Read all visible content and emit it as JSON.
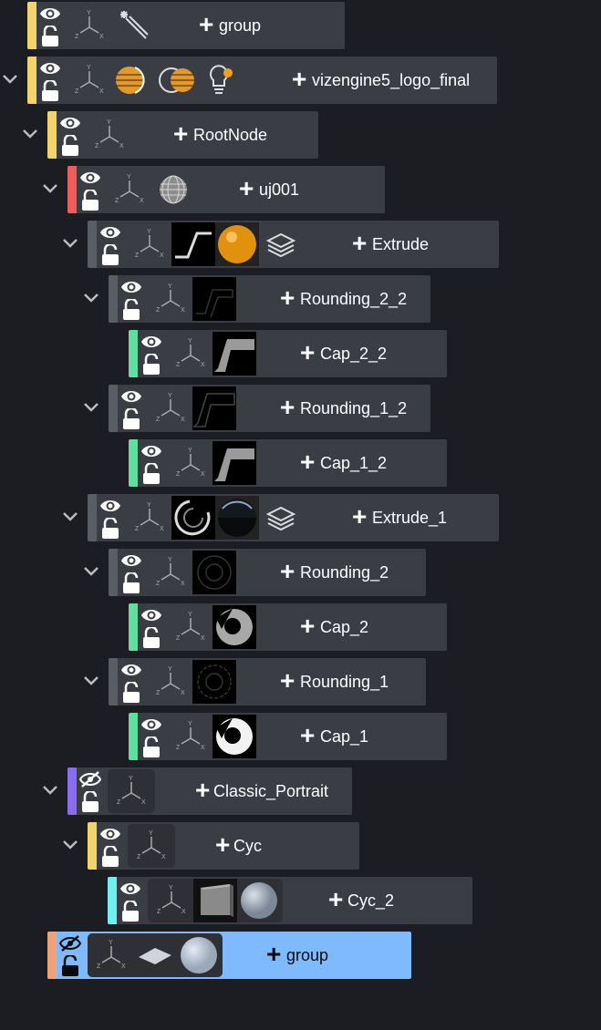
{
  "colors": {
    "background": "#1b1d22",
    "node_bg": "#3a3d44",
    "selected_bg": "#7fbaff",
    "yellow": "#f3d36b",
    "red": "#f05b5b",
    "green": "#5fe0a0",
    "purple": "#8a6cf0",
    "cyan": "#6ff0f0",
    "orange": "#f0a27a"
  },
  "nodes": [
    {
      "label": "group",
      "expander": false,
      "bar": "yellow",
      "visible": true,
      "thumbs": [
        "magic-wand-icon"
      ]
    },
    {
      "label": "vizengine5_logo_final",
      "expander": true,
      "bar": "yellow",
      "visible": true,
      "thumbs": [
        "orange-sphere-half-icon",
        "orange-sphere-outline-icon",
        "light-bulb-icon"
      ]
    },
    {
      "label": "RootNode",
      "expander": true,
      "bar": "yellow",
      "visible": true,
      "thumbs": []
    },
    {
      "label": "uj001",
      "expander": true,
      "bar": "red",
      "visible": true,
      "thumbs": [
        "wire-sphere-icon"
      ]
    },
    {
      "label": "Extrude",
      "expander": true,
      "bar": "none",
      "visible": true,
      "thumbs": [
        "stroke-z-shape-thumb",
        "orange-ball-thumb",
        "layers-icon"
      ]
    },
    {
      "label": "Rounding_2_2",
      "expander": true,
      "bar": "none",
      "visible": true,
      "thumbs": [
        "dark-z-shape-thumb"
      ]
    },
    {
      "label": "Cap_2_2",
      "expander": false,
      "bar": "green",
      "visible": true,
      "thumbs": [
        "gray-z-shape-thumb"
      ]
    },
    {
      "label": "Rounding_1_2",
      "expander": true,
      "bar": "none",
      "visible": true,
      "thumbs": [
        "dark-z-shape-thumb"
      ]
    },
    {
      "label": "Cap_1_2",
      "expander": false,
      "bar": "green",
      "visible": true,
      "thumbs": [
        "gray-z-shape-thumb"
      ]
    },
    {
      "label": "Extrude_1",
      "expander": true,
      "bar": "none",
      "visible": true,
      "thumbs": [
        "ring-thumb",
        "dark-ball-thumb",
        "layers-icon"
      ]
    },
    {
      "label": "Rounding_2",
      "expander": true,
      "bar": "none",
      "visible": true,
      "thumbs": [
        "dark-ring-thumb"
      ]
    },
    {
      "label": "Cap_2",
      "expander": false,
      "bar": "green",
      "visible": true,
      "thumbs": [
        "gray-ring-thumb"
      ]
    },
    {
      "label": "Rounding_1",
      "expander": true,
      "bar": "none",
      "visible": true,
      "thumbs": [
        "dark-ring-thumb"
      ]
    },
    {
      "label": "Cap_1",
      "expander": false,
      "bar": "green",
      "visible": true,
      "thumbs": [
        "white-ring-thumb"
      ]
    },
    {
      "label": "Classic_Portrait",
      "expander": true,
      "bar": "purple",
      "visible": false,
      "thumbs": []
    },
    {
      "label": "Cyc",
      "expander": true,
      "bar": "yellow",
      "visible": true,
      "thumbs": []
    },
    {
      "label": "Cyc_2",
      "expander": false,
      "bar": "cyan",
      "visible": true,
      "thumbs": [
        "gray-cube-thumb",
        "gray-sphere-thumb"
      ]
    },
    {
      "label": "group",
      "expander": false,
      "bar": "orange",
      "visible": false,
      "selected": true,
      "thumbs": [
        "flat-plane-thumb",
        "gray-sphere-thumb"
      ]
    }
  ]
}
